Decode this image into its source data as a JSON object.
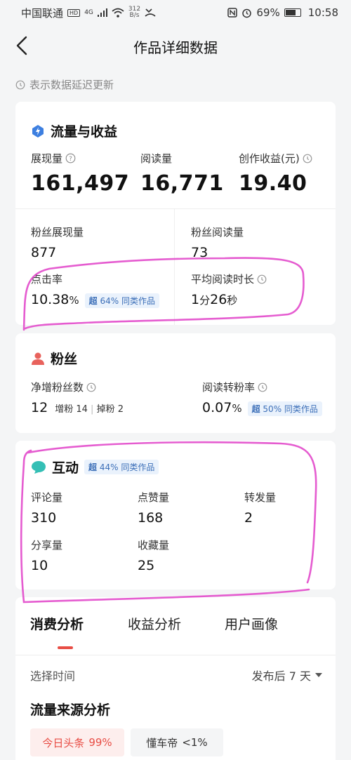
{
  "status_bar": {
    "carrier": "中国联通",
    "hd": "HD",
    "signal_gen": "4G",
    "speed_value": "312",
    "speed_unit": "B/s",
    "battery": "69%",
    "battery_level": 0.69,
    "time": "10:58"
  },
  "header": {
    "title": "作品详细数据"
  },
  "delay_note": "表示数据延迟更新",
  "traffic": {
    "title": "流量与收益",
    "impressions_label": "展现量",
    "impressions_value": "161,497",
    "reads_label": "阅读量",
    "reads_value": "16,771",
    "earnings_label": "创作收益(元)",
    "earnings_value": "19.40",
    "fan_impressions_label": "粉丝展现量",
    "fan_impressions_value": "877",
    "fan_reads_label": "粉丝阅读量",
    "fan_reads_value": "73",
    "ctr_label": "点击率",
    "ctr_value": "10.38",
    "ctr_unit": "%",
    "ctr_badge_prefix": "超",
    "ctr_badge_pct": "64%",
    "ctr_badge_suffix": "同类作品",
    "avg_read_label": "平均阅读时长",
    "avg_read_min": "1",
    "avg_read_min_unit": "分",
    "avg_read_sec": "26",
    "avg_read_sec_unit": "秒"
  },
  "fans": {
    "title": "粉丝",
    "net_label": "净增粉丝数",
    "net_value": "12",
    "gain_label": "增粉",
    "gain_value": "14",
    "lost_label": "掉粉",
    "lost_value": "2",
    "conv_label": "阅读转粉率",
    "conv_value": "0.07",
    "conv_unit": "%",
    "conv_badge_prefix": "超",
    "conv_badge_pct": "50%",
    "conv_badge_suffix": "同类作品"
  },
  "interaction": {
    "title": "互动",
    "badge_prefix": "超",
    "badge_pct": "44%",
    "badge_suffix": "同类作品",
    "comments_label": "评论量",
    "comments_value": "310",
    "likes_label": "点赞量",
    "likes_value": "168",
    "forwards_label": "转发量",
    "forwards_value": "2",
    "shares_label": "分享量",
    "shares_value": "10",
    "favorites_label": "收藏量",
    "favorites_value": "25"
  },
  "tabs": [
    "消费分析",
    "收益分析",
    "用户画像"
  ],
  "time_select": {
    "label": "选择时间",
    "value": "发布后 7 天"
  },
  "source": {
    "title": "流量来源分析",
    "chip1_name": "今日头条",
    "chip1_value": "99%",
    "chip2_name": "懂车帝",
    "chip2_value": "<1%"
  },
  "colors": {
    "accent": "#e84d45",
    "badge_text": "#3c6fb8",
    "annotation": "#e040c8"
  }
}
